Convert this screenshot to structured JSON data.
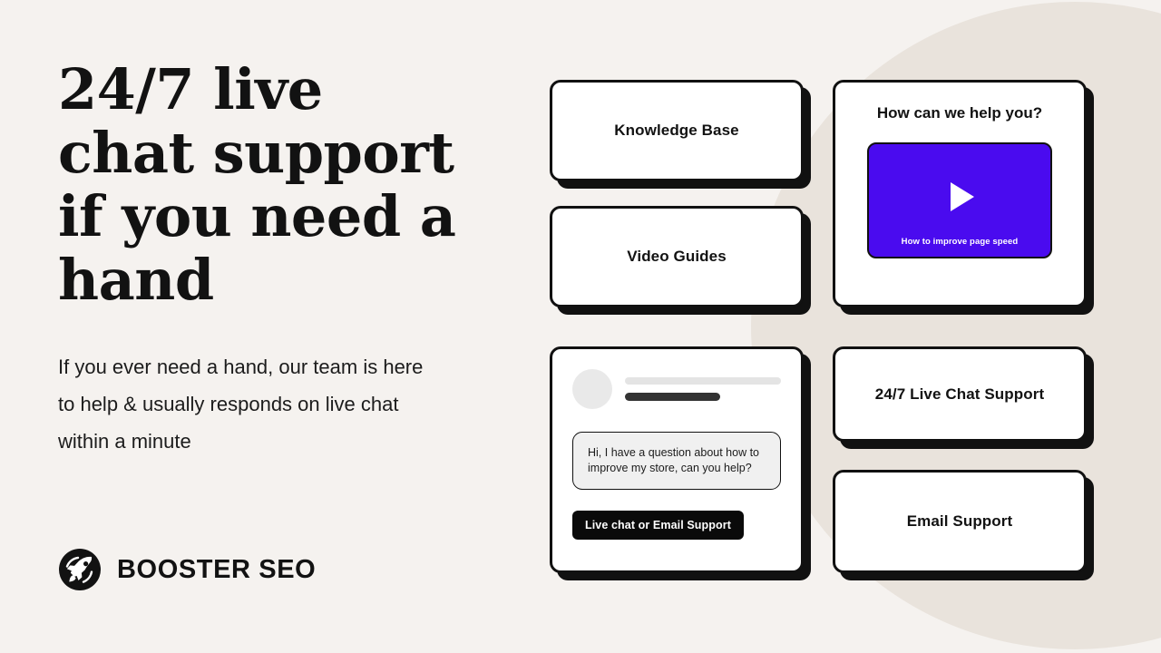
{
  "theme": {
    "background": "#F5F2EF",
    "circle": "#E9E3DC",
    "ink": "#121212",
    "accent_purple": "#4A0BEF",
    "card_border": "#111111",
    "card_bg": "#FFFFFF"
  },
  "hero": {
    "headline": "24/7 live chat support if you need a hand",
    "subhead": "If you ever need a hand, our team is here to help & usually responds on live chat within a minute"
  },
  "brand": {
    "name": "BOOSTER SEO",
    "logo_icon": "rocket-icon"
  },
  "cards": {
    "knowledge_base": {
      "label": "Knowledge Base"
    },
    "video_guides": {
      "label": "Video Guides"
    },
    "live_chat_support": {
      "label": "24/7 Live Chat Support"
    },
    "email_support": {
      "label": "Email Support"
    }
  },
  "video_card": {
    "title": "How can we help you?",
    "thumbnail_caption": "How to improve page speed",
    "play_icon": "play-icon"
  },
  "chat_card": {
    "avatar_icon": "avatar-placeholder",
    "skeleton_bars": [
      "name-placeholder-bar",
      "subtitle-placeholder-bar"
    ],
    "message": "Hi, I have a question about how to improve my store, can you help?",
    "button_label": "Live chat or Email Support"
  }
}
